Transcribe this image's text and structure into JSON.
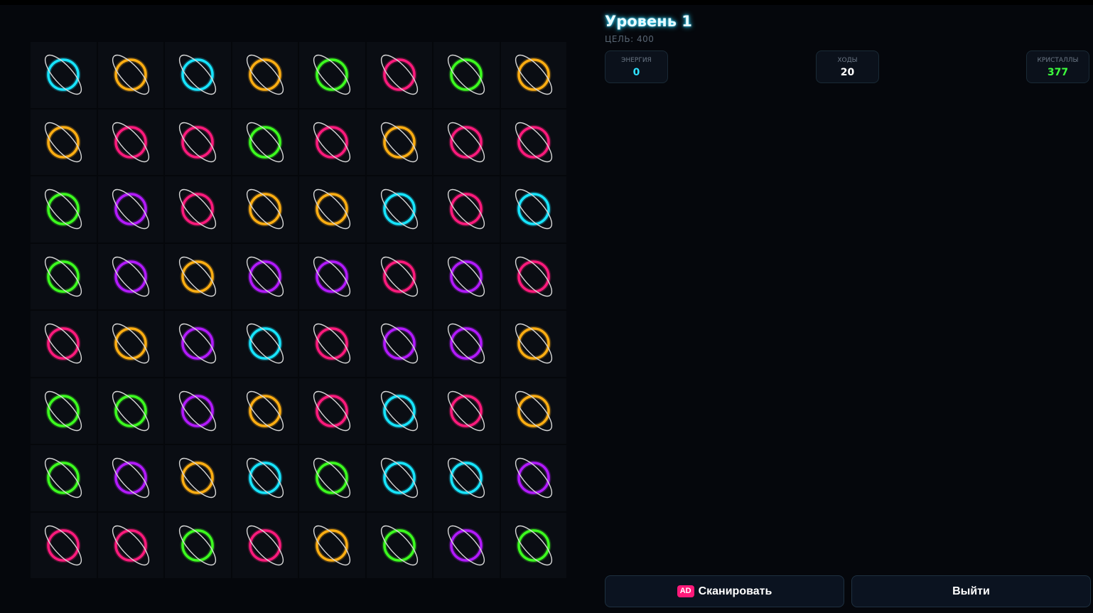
{
  "header": {
    "level_title": "Уровень 1",
    "goal_text": "ЦЕЛЬ: 400"
  },
  "stats": [
    {
      "label": "ЭНЕРГИЯ",
      "value": "0",
      "color": "#2fe0ff"
    },
    {
      "label": "ХОДЫ",
      "value": "20",
      "color": "#ffffff"
    },
    {
      "label": "КРИСТАЛЛЫ",
      "value": "377",
      "color": "#3dff3d"
    }
  ],
  "buttons": {
    "ad_badge": "AD",
    "scan_label": "Сканировать",
    "exit_label": "Выйти"
  },
  "colors": {
    "cyan": "#17e5ff",
    "orange": "#ffae12",
    "green": "#3dff1f",
    "pink": "#ff1a7c",
    "purple": "#b31aff"
  },
  "board": {
    "rows": 8,
    "cols": 8,
    "tiles": [
      [
        "cyan",
        "orange",
        "cyan",
        "orange",
        "green",
        "pink",
        "green",
        "orange"
      ],
      [
        "orange",
        "pink",
        "pink",
        "green",
        "pink",
        "orange",
        "pink",
        "pink"
      ],
      [
        "green",
        "purple",
        "pink",
        "orange",
        "orange",
        "cyan",
        "pink",
        "cyan"
      ],
      [
        "green",
        "purple",
        "orange",
        "purple",
        "purple",
        "pink",
        "purple",
        "pink"
      ],
      [
        "pink",
        "orange",
        "purple",
        "cyan",
        "pink",
        "purple",
        "purple",
        "orange"
      ],
      [
        "green",
        "green",
        "purple",
        "orange",
        "pink",
        "cyan",
        "pink",
        "orange"
      ],
      [
        "green",
        "purple",
        "orange",
        "cyan",
        "green",
        "cyan",
        "cyan",
        "purple"
      ],
      [
        "pink",
        "pink",
        "green",
        "pink",
        "orange",
        "green",
        "purple",
        "green"
      ]
    ]
  }
}
